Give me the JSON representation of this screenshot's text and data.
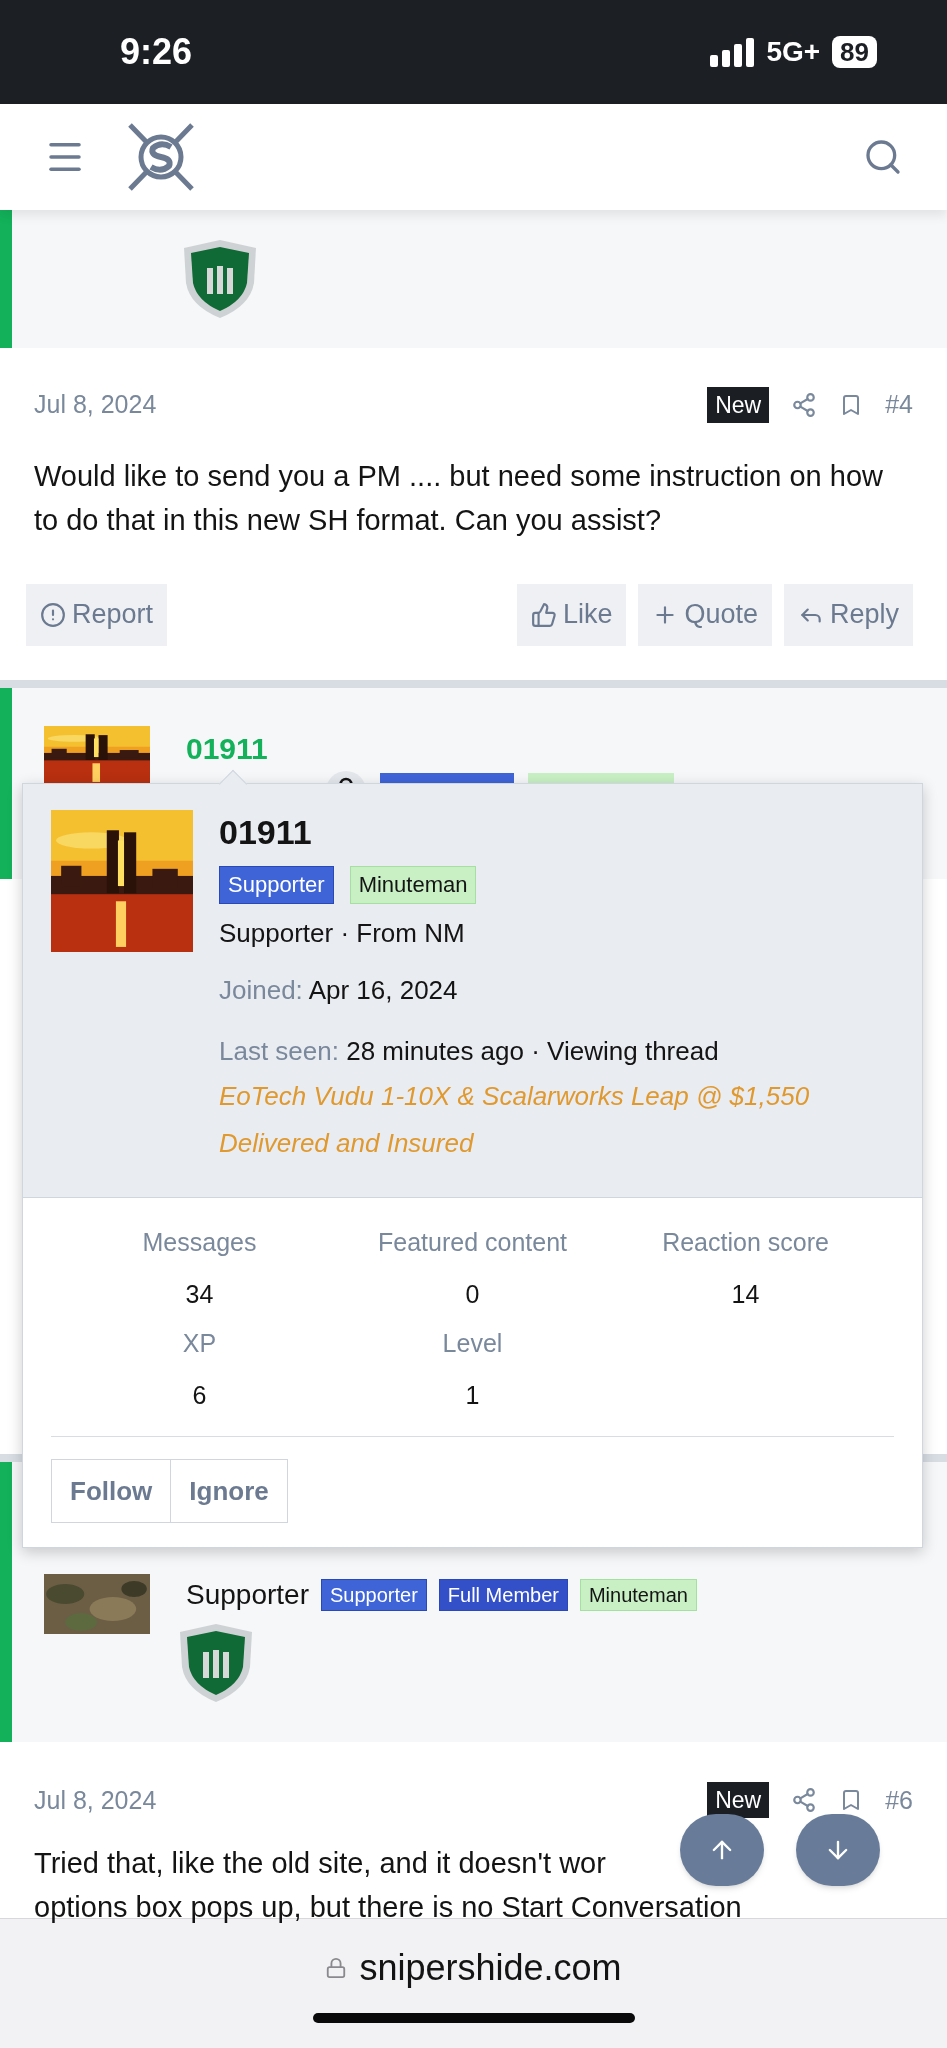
{
  "status_bar": {
    "time": "9:26",
    "network": "5G+",
    "battery": "89"
  },
  "post_4": {
    "date": "Jul 8, 2024",
    "badge": "New",
    "number": "#4",
    "body": "Would like to send you a PM .... but need some instruction on how to do that in this new SH format. Can you assist?",
    "actions": [
      {
        "kind": "report",
        "label": "Report"
      },
      {
        "kind": "like",
        "label": "Like"
      },
      {
        "kind": "quote",
        "label": "Quote"
      },
      {
        "kind": "reply",
        "label": "Reply"
      }
    ]
  },
  "user_5": {
    "name": "01911"
  },
  "popup": {
    "name": "01911",
    "badges": [
      {
        "label": "Supporter",
        "color": "#3f64d8"
      },
      {
        "label": "Minuteman",
        "color": "#c8f0c4"
      }
    ],
    "title": "Supporter · From NM",
    "joined_label": "Joined:",
    "joined": "Apr 16, 2024",
    "last_seen_label": "Last seen:",
    "last_seen": "28 minutes ago · Viewing thread",
    "signature": "EoTech Vudu 1-10X & Scalarworks Leap @ $1,550 Delivered and Insured",
    "stats": [
      {
        "label": "Messages",
        "value": "34"
      },
      {
        "label": "Featured content",
        "value": "0"
      },
      {
        "label": "Reaction score",
        "value": "14"
      },
      {
        "label": "XP",
        "value": "6"
      },
      {
        "label": "Level",
        "value": "1"
      }
    ],
    "buttons": [
      "Follow",
      "Ignore"
    ]
  },
  "user_6": {
    "title": "Supporter",
    "badges": [
      {
        "label": "Supporter",
        "color": "#3f64d8"
      },
      {
        "label": "Full Member",
        "color": "#3450c8"
      },
      {
        "label": "Minuteman",
        "color": "#c8f0c4"
      }
    ]
  },
  "post_6": {
    "date": "Jul 8, 2024",
    "badge": "New",
    "number": "#6",
    "body_lines": [
      "Tried that, like the old site, and it doesn't wor",
      "options box pops up, but there is no Start Conversation"
    ]
  },
  "browser": {
    "url": "snipershide.com"
  }
}
